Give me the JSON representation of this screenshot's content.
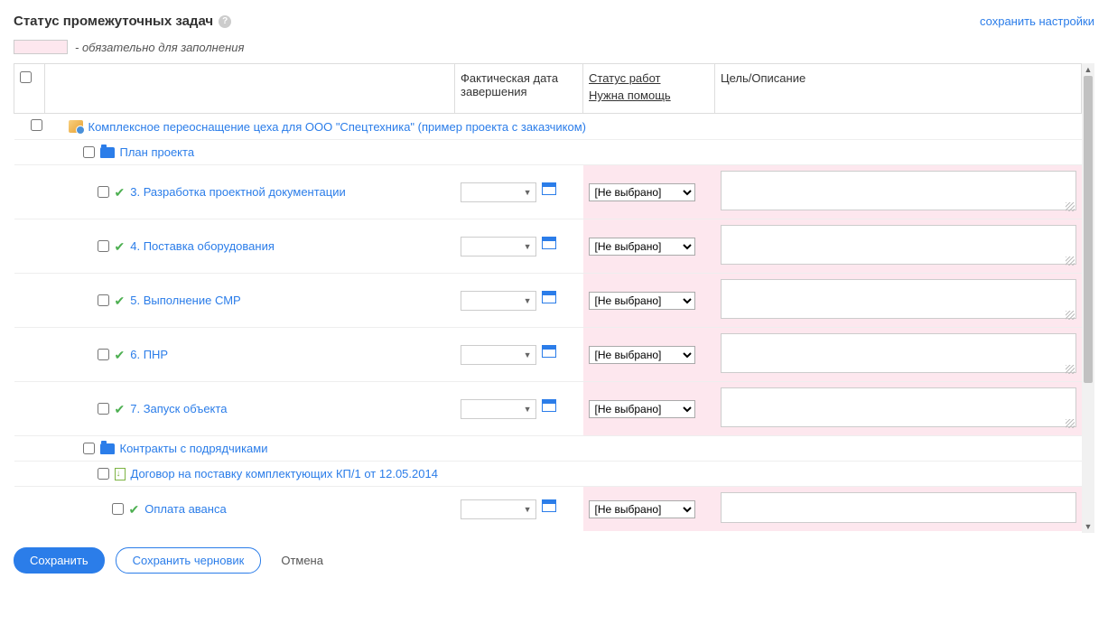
{
  "header": {
    "title": "Статус промежуточных задач",
    "save_settings": "сохранить настройки"
  },
  "legend": {
    "text": "- обязательно для заполнения"
  },
  "columns": {
    "date": "Фактическая дата завершения",
    "status": "Статус работ",
    "help": "Нужна помощь",
    "desc": "Цель/Описание"
  },
  "select_placeholder": "[Не выбрано]",
  "project": {
    "title": "Комплексное переоснащение цеха для ООО \"Спецтехника\" (пример проекта с заказчиком)"
  },
  "plan": {
    "title": "План проекта"
  },
  "tasks": [
    {
      "name": "3. Разработка проектной документации"
    },
    {
      "name": "4. Поставка оборудования"
    },
    {
      "name": "5. Выполнение СМР"
    },
    {
      "name": "6. ПНР"
    },
    {
      "name": "7. Запуск объекта"
    }
  ],
  "contracts": {
    "title": "Контракты с подрядчиками"
  },
  "contract_doc": {
    "title": "Договор на поставку комплектующих КП/1 от 12.05.2014"
  },
  "advance": {
    "name": "Оплата аванса"
  },
  "footer": {
    "save": "Сохранить",
    "draft": "Сохранить черновик",
    "cancel": "Отмена"
  }
}
